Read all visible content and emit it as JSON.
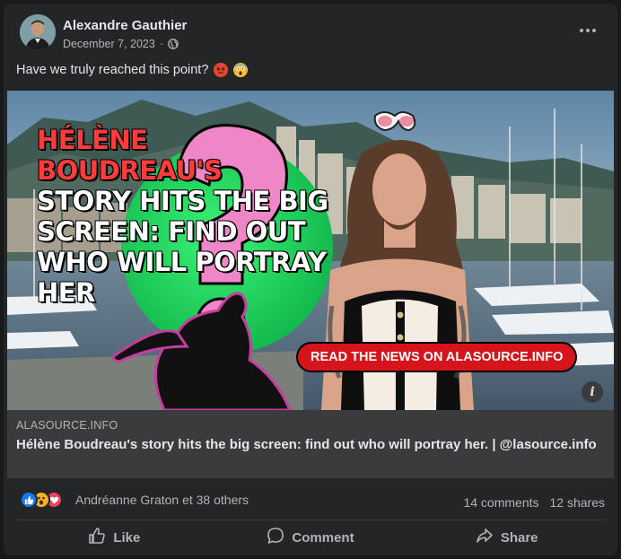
{
  "post": {
    "author": "Alexandre Gauthier",
    "date": "December 7, 2023",
    "separator": "·",
    "audience_icon": "globe-icon",
    "more_icon": "more-options-icon",
    "caption": "Have we truly reached this point?",
    "caption_emojis": [
      "angry-face-emoji",
      "screaming-face-emoji"
    ]
  },
  "preview": {
    "headline_red": "HÉLÈNE BOUDREAU'S",
    "headline_white": "STORY HITS THE BIG SCREEN: FIND OUT WHO WILL PORTRAY HER",
    "cta": "READ THE NEWS ON ALASOURCE.INFO",
    "info_icon": "i"
  },
  "link": {
    "domain": "ALASOURCE.INFO",
    "title": "Hélène Boudreau's story hits the big screen: find out who will portray her. | @lasource.info"
  },
  "reactions": {
    "icons": [
      "like-reaction-icon",
      "wow-reaction-icon",
      "love-reaction-icon"
    ],
    "names": "Andréanne Graton et 38 others",
    "comments": "14 comments",
    "shares": "12 shares"
  },
  "actions": {
    "like": "Like",
    "comment": "Comment",
    "share": "Share"
  },
  "colors": {
    "background": "#18191a",
    "card": "#242526",
    "link_box": "#3a3b3c",
    "text_primary": "#e4e6eb",
    "text_secondary": "#b0b3b8",
    "cta_red": "#d5141b",
    "headline_red": "#ff3b3b",
    "like_blue": "#1877f2",
    "love_red": "#f33e58",
    "wow_yellow": "#f7b125"
  }
}
